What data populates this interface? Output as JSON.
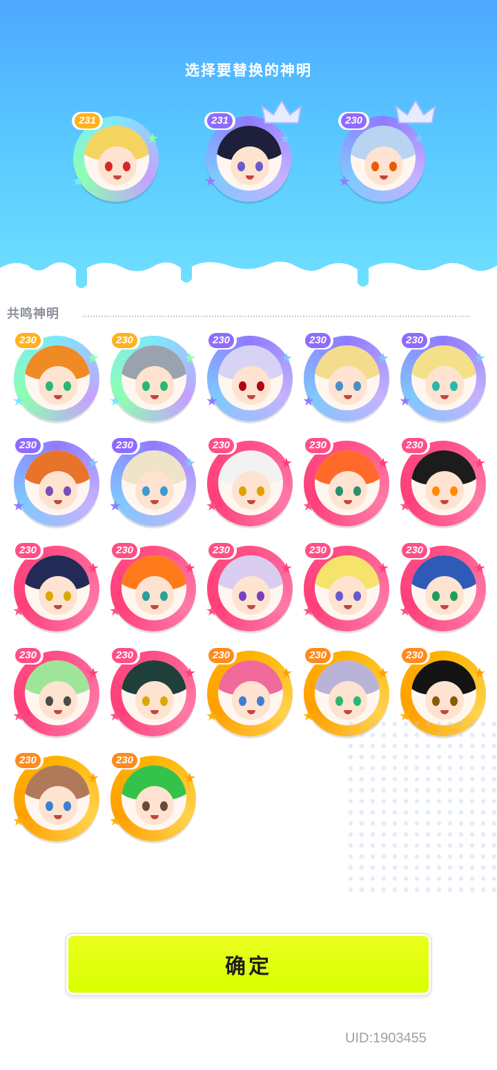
{
  "header": {
    "title": "选择要替换的神明"
  },
  "selected": [
    {
      "level": "231",
      "rarity": "rainbow",
      "hair": "#f4d35e",
      "eye": "#d62828",
      "crown": false
    },
    {
      "level": "231",
      "rarity": "purple",
      "hair": "#1e1f3b",
      "eye": "#6a5acd",
      "crown": true
    },
    {
      "level": "230",
      "rarity": "purple",
      "hair": "#b8d4f0",
      "eye": "#e85d04",
      "crown": true
    }
  ],
  "section": {
    "label": "共鸣神明"
  },
  "gods": [
    {
      "level": "230",
      "rarity": "rainbow",
      "hair": "#f08a24",
      "eye": "#2bb673"
    },
    {
      "level": "230",
      "rarity": "rainbow",
      "hair": "#9aa3ad",
      "eye": "#2bb673"
    },
    {
      "level": "230",
      "rarity": "purple",
      "hair": "#d8d2f5",
      "eye": "#b3001b"
    },
    {
      "level": "230",
      "rarity": "purple",
      "hair": "#f3dc8c",
      "eye": "#4a90c2"
    },
    {
      "level": "230",
      "rarity": "purple",
      "hair": "#f5e08a",
      "eye": "#2bb6a8"
    },
    {
      "level": "230",
      "rarity": "purple",
      "hair": "#e8742a",
      "eye": "#7a4fb5"
    },
    {
      "level": "230",
      "rarity": "purple",
      "hair": "#efe4c8",
      "eye": "#3d9ad1"
    },
    {
      "level": "230",
      "rarity": "pink",
      "hair": "#f2f2f2",
      "eye": "#e0a100"
    },
    {
      "level": "230",
      "rarity": "pink",
      "hair": "#ff6a2b",
      "eye": "#2b8f6e"
    },
    {
      "level": "230",
      "rarity": "pink",
      "hair": "#1c1c1c",
      "eye": "#ff8a00"
    },
    {
      "level": "230",
      "rarity": "pink",
      "hair": "#222a55",
      "eye": "#d9a900"
    },
    {
      "level": "230",
      "rarity": "pink",
      "hair": "#ff7a1a",
      "eye": "#2aa198"
    },
    {
      "level": "230",
      "rarity": "pink",
      "hair": "#d9cdf0",
      "eye": "#7b3fbf"
    },
    {
      "level": "230",
      "rarity": "pink",
      "hair": "#f5e36b",
      "eye": "#6a5acd"
    },
    {
      "level": "230",
      "rarity": "pink",
      "hair": "#2f5bb7",
      "eye": "#1f9e5a"
    },
    {
      "level": "230",
      "rarity": "pink",
      "hair": "#9ee59a",
      "eye": "#4a4a4a"
    },
    {
      "level": "230",
      "rarity": "pink",
      "hair": "#1f3f3a",
      "eye": "#d9a900"
    },
    {
      "level": "230",
      "rarity": "gold",
      "hair": "#f06a9b",
      "eye": "#3d7fd1"
    },
    {
      "level": "230",
      "rarity": "gold",
      "hair": "#b9b3d8",
      "eye": "#2bb673"
    },
    {
      "level": "230",
      "rarity": "gold",
      "hair": "#141414",
      "eye": "#8a5a00"
    },
    {
      "level": "230",
      "rarity": "gold",
      "hair": "#b07a5a",
      "eye": "#3d7fd1"
    },
    {
      "level": "230",
      "rarity": "gold",
      "hair": "#35c24a",
      "eye": "#6a4a3a"
    }
  ],
  "rarity_colors": {
    "rainbow": [
      "#7ee8fa",
      "#c4a1ff",
      "#8dffb0"
    ],
    "purple": [
      "#8f7bff",
      "#c4b2ff",
      "#7fc8ff"
    ],
    "pink": [
      "#ff4f86",
      "#ff7aa8",
      "#ff3f7a"
    ],
    "gold": [
      "#ffb300",
      "#ffd24d",
      "#ffa000"
    ]
  },
  "level_colors": {
    "rainbow": "#ffb21e",
    "purple": "#8f6bff",
    "pink": "#ff4f86",
    "gold": "#ff8a1e"
  },
  "confirm": {
    "label": "确定"
  },
  "footer": {
    "uid": "UID:1903455"
  }
}
